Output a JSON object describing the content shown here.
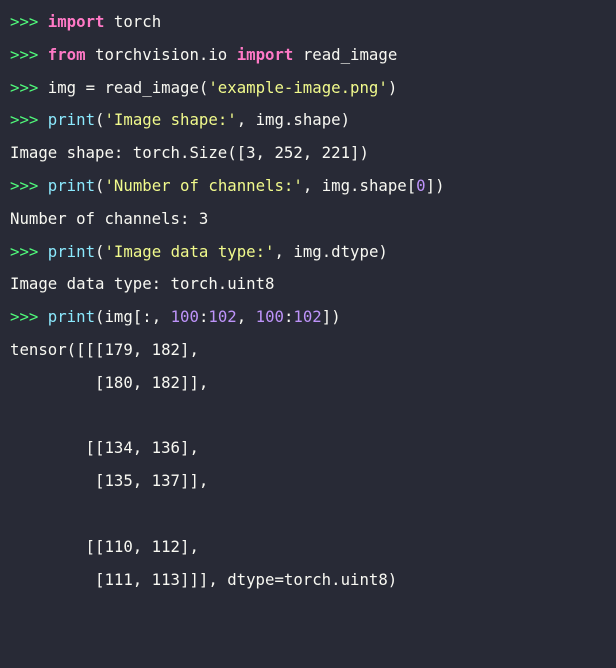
{
  "console": {
    "prompt": ">>>",
    "lines": [
      {
        "type": "input",
        "tokens": [
          {
            "cls": "kw",
            "text": "import"
          },
          {
            "cls": "tx",
            "text": " torch"
          }
        ]
      },
      {
        "type": "input",
        "tokens": [
          {
            "cls": "kw",
            "text": "from"
          },
          {
            "cls": "tx",
            "text": " torchvision.io "
          },
          {
            "cls": "kw",
            "text": "import"
          },
          {
            "cls": "tx",
            "text": " read_image"
          }
        ]
      },
      {
        "type": "input",
        "tokens": [
          {
            "cls": "tx",
            "text": "img = read_image("
          },
          {
            "cls": "str",
            "text": "'example-image.png'"
          },
          {
            "cls": "tx",
            "text": ")"
          }
        ]
      },
      {
        "type": "input",
        "tokens": [
          {
            "cls": "fn",
            "text": "print"
          },
          {
            "cls": "tx",
            "text": "("
          },
          {
            "cls": "str",
            "text": "'Image shape:'"
          },
          {
            "cls": "tx",
            "text": ", img.shape)"
          }
        ]
      },
      {
        "type": "output",
        "text": "Image shape: torch.Size([3, 252, 221])"
      },
      {
        "type": "input",
        "tokens": [
          {
            "cls": "fn",
            "text": "print"
          },
          {
            "cls": "tx",
            "text": "("
          },
          {
            "cls": "str",
            "text": "'Number of channels:'"
          },
          {
            "cls": "tx",
            "text": ", img.shape["
          },
          {
            "cls": "num",
            "text": "0"
          },
          {
            "cls": "tx",
            "text": "])"
          }
        ]
      },
      {
        "type": "output",
        "text": "Number of channels: 3"
      },
      {
        "type": "input",
        "tokens": [
          {
            "cls": "fn",
            "text": "print"
          },
          {
            "cls": "tx",
            "text": "("
          },
          {
            "cls": "str",
            "text": "'Image data type:'"
          },
          {
            "cls": "tx",
            "text": ", img.dtype)"
          }
        ]
      },
      {
        "type": "output",
        "text": "Image data type: torch.uint8"
      },
      {
        "type": "input",
        "tokens": [
          {
            "cls": "fn",
            "text": "print"
          },
          {
            "cls": "tx",
            "text": "(img[:, "
          },
          {
            "cls": "num",
            "text": "100"
          },
          {
            "cls": "tx",
            "text": ":"
          },
          {
            "cls": "num",
            "text": "102"
          },
          {
            "cls": "tx",
            "text": ", "
          },
          {
            "cls": "num",
            "text": "100"
          },
          {
            "cls": "tx",
            "text": ":"
          },
          {
            "cls": "num",
            "text": "102"
          },
          {
            "cls": "tx",
            "text": "])"
          }
        ]
      },
      {
        "type": "output",
        "text": "tensor([[[179, 182],"
      },
      {
        "type": "output",
        "text": "         [180, 182]],"
      },
      {
        "type": "output",
        "text": ""
      },
      {
        "type": "output",
        "text": "        [[134, 136],"
      },
      {
        "type": "output",
        "text": "         [135, 137]],"
      },
      {
        "type": "output",
        "text": ""
      },
      {
        "type": "output",
        "text": "        [[110, 112],"
      },
      {
        "type": "output",
        "text": "         [111, 113]]], dtype=torch.uint8)"
      }
    ]
  },
  "colors": {
    "background": "#282a36",
    "prompt": "#50fa7b",
    "keyword": "#ff79c6",
    "function": "#8be9fd",
    "string": "#f1fa8c",
    "number": "#bd93f9",
    "text": "#f8f8f2"
  }
}
